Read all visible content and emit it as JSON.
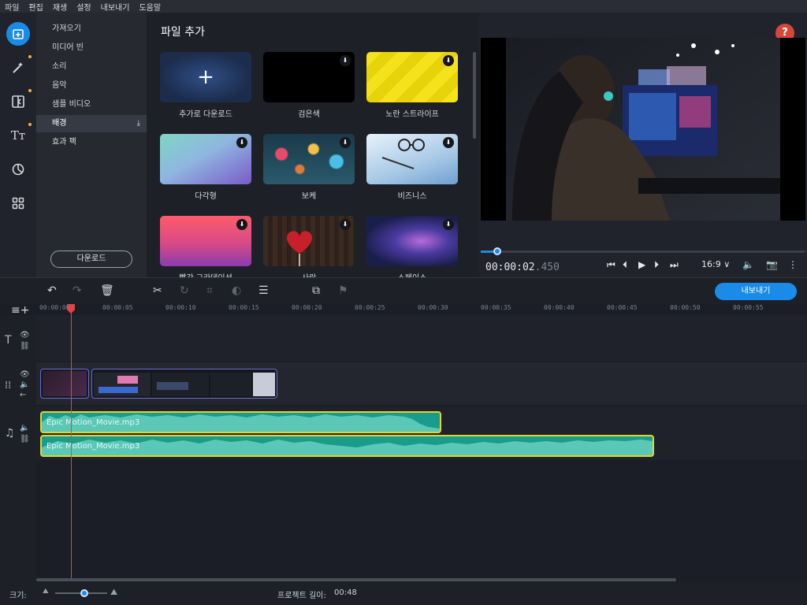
{
  "menu": [
    "파일",
    "편집",
    "재생",
    "설정",
    "내보내기",
    "도움말"
  ],
  "categories": [
    {
      "label": "가져오기"
    },
    {
      "label": "미디어 빈"
    },
    {
      "label": "소리"
    },
    {
      "label": "음악"
    },
    {
      "label": "샘플 비디오"
    },
    {
      "label": "배경",
      "selected": true
    },
    {
      "label": "효과 팩"
    }
  ],
  "categories_download_label": "다운로드",
  "files": {
    "title": "파일 추가",
    "items": [
      {
        "label": "추가로 다운로드",
        "kind": "add"
      },
      {
        "label": "검은색",
        "kind": "black"
      },
      {
        "label": "노란 스트라이프",
        "kind": "stripes"
      },
      {
        "label": "다각형",
        "kind": "polygon"
      },
      {
        "label": "보케",
        "kind": "bokeh"
      },
      {
        "label": "비즈니스",
        "kind": "business"
      },
      {
        "label": "빨간 그라데이션",
        "kind": "gradient"
      },
      {
        "label": "사랑",
        "kind": "love"
      },
      {
        "label": "스페이스",
        "kind": "space"
      }
    ]
  },
  "preview": {
    "help": "?",
    "time_main": "00:00:02",
    "time_ms": ".450",
    "aspect": "16:9 ∨",
    "progress": 0.05
  },
  "toolbar": {
    "export": "내보내기"
  },
  "ruler": [
    "00:00:00",
    "00:00:05",
    "00:00:10",
    "00:00:15",
    "00:00:20",
    "00:00:25",
    "00:00:30",
    "00:00:35",
    "00:00:40",
    "00:00:45",
    "00:00:50",
    "00:00:55"
  ],
  "audio_clips": [
    {
      "name": "Epic Motion_Movie.mp3"
    },
    {
      "name": "Epic Motion_Movie.mp3"
    }
  ],
  "status": {
    "zoom_label": "크기:",
    "length_label": "프로젝트 길이:",
    "length_value": "00:48"
  },
  "colors": {
    "accent": "#1a8be8",
    "audio_clip": "#1a9c8c",
    "audio_border": "#e0d52c",
    "playhead": "#e04646",
    "help": "#d6473a"
  }
}
